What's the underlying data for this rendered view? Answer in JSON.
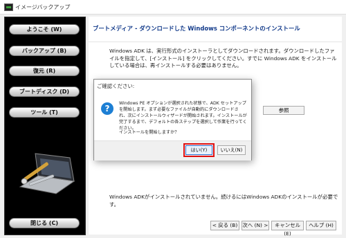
{
  "window": {
    "title": "イメージバックアップ"
  },
  "sidebar": {
    "items": [
      {
        "label": "ようこそ (W)"
      },
      {
        "label": "バックアップ (B)"
      },
      {
        "label": "復元 (R)"
      },
      {
        "label": "ブートディスク (D)"
      },
      {
        "label": "ツール (T)"
      }
    ],
    "close_label": "閉じる (C)"
  },
  "header": {
    "title": "ブートメディア - ダウンロードした Windows コンポーネントのインストール"
  },
  "content": {
    "description": "Windows ADK は、実行形式のインストーラとしてダウンロードされます。ダウンロードしたファイルを指定して、[インストール] をクリックしてください。すでに Windows ADK をインストールしている場合は、再インストールする必要はありません。",
    "browse_label": "参照",
    "status": "Windows ADKがインストールされていません。続けるにはWindows ADKのインストールが必要です。"
  },
  "footer": {
    "back_label": "< 戻る (B)",
    "next_label": "次へ (N) >",
    "cancel_label": "キャンセル (E)",
    "help_label": "ヘルプ (H)"
  },
  "dialog": {
    "title": "ご確認ください:",
    "message": "Windows PE オプションが選択された状態で、ADK セットアップを開始します。まず必要なファイルが自動的にダウンロードされ、次にインストールウィザードが開始されます。インストールが完了するまで、デフォルトの各ステップを選択して作業を行ってください。",
    "question": "インストールを開始しますか？",
    "yes_label": "はい(Y)",
    "no_label": "いいえ(N)"
  }
}
